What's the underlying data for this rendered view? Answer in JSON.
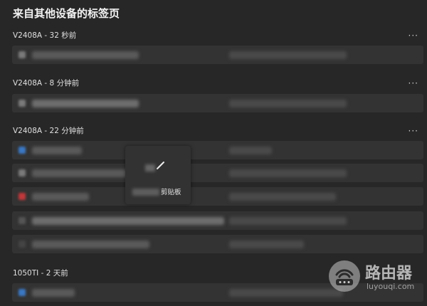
{
  "page": {
    "title": "来自其他设备的标签页"
  },
  "groups": [
    {
      "device": "V2408A - 32 秒前",
      "more": "···"
    },
    {
      "device": "V2408A - 8 分钟前",
      "more": "···"
    },
    {
      "device": "V2408A - 22 分钟前",
      "more": "···"
    },
    {
      "device": "1050TI - 2 天前",
      "more": "···"
    }
  ],
  "context_menu": {
    "copy_label_suffix": "剪贴板",
    "icon": "pen-icon"
  },
  "watermark": {
    "title": "路由器",
    "domain": "luyouqi.com",
    "icon": "router-icon"
  },
  "colors": {
    "background": "#272727",
    "row": "#333333",
    "text": "#e6e6e6"
  }
}
